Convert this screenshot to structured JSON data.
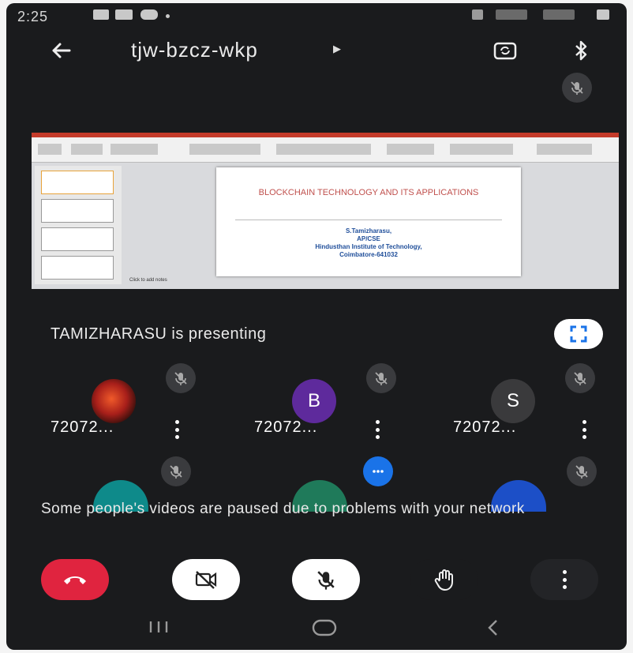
{
  "status": {
    "time": "2:25"
  },
  "meeting": {
    "code": "tjw-bzcz-wkp"
  },
  "slide": {
    "title": "BLOCKCHAIN TECHNOLOGY AND ITS APPLICATIONS",
    "author": "S.Tamizharasu,",
    "role": "AP/CSE",
    "institute": "Hindusthan Institute of Technology,",
    "city": "Coimbatore-641032",
    "notes_placeholder": "Click to add notes"
  },
  "presenting_text": "TAMIZHARASU is presenting",
  "participants": [
    {
      "initial": "",
      "name": "72072..."
    },
    {
      "initial": "B",
      "name": "72072...",
      "color": "#5e2a9c"
    },
    {
      "initial": "S",
      "name": "72072...",
      "color": "#3a3a3c"
    }
  ],
  "peek_colors": [
    "#0e8a8a",
    "#1f7a5a",
    "#1c4fc7"
  ],
  "network_notice": "Some people's videos are paused due to problems with your network",
  "controls": {
    "end_call_color": "#e0243f",
    "accent": "#1a73e8"
  }
}
